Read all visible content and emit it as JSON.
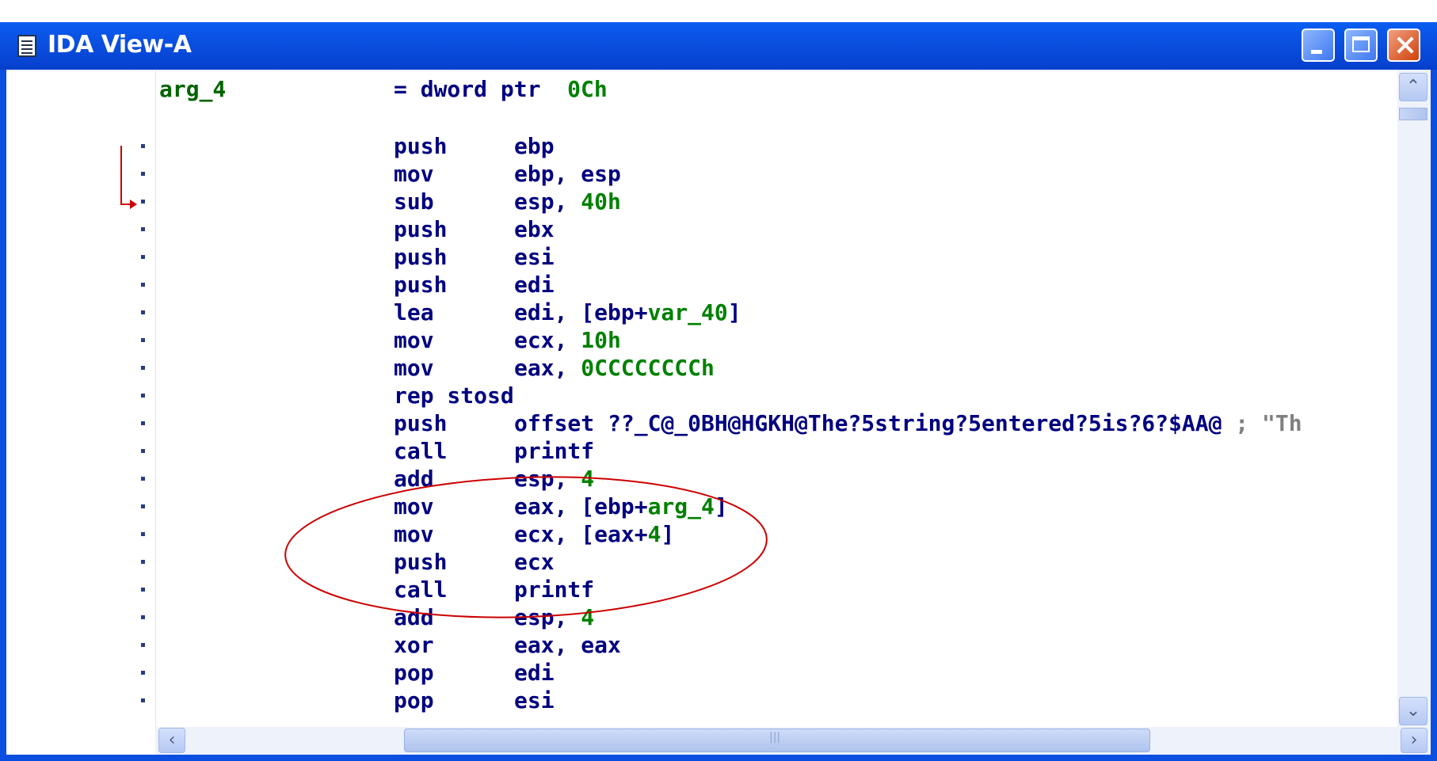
{
  "window": {
    "title": "IDA View-A",
    "title_icon": "document-icon",
    "buttons": [
      "minimize-icon",
      "maximize-icon",
      "close-icon"
    ]
  },
  "colors": {
    "titlebar": "#0a4fe0",
    "mnemonic": "#000080",
    "number": "#008000",
    "label": "#006400",
    "comment": "#808080",
    "annotation": "#cc0000"
  },
  "listing": {
    "header": {
      "label": "arg_4",
      "eq": "= dword ptr",
      "value": "0Ch"
    },
    "lines": [
      {
        "mnem": "push",
        "op": "ebp",
        "num": ""
      },
      {
        "mnem": "mov",
        "op": "ebp, esp",
        "num": ""
      },
      {
        "mnem": "sub",
        "op": "esp, ",
        "num": "40h"
      },
      {
        "mnem": "push",
        "op": "ebx",
        "num": ""
      },
      {
        "mnem": "push",
        "op": "esi",
        "num": ""
      },
      {
        "mnem": "push",
        "op": "edi",
        "num": ""
      },
      {
        "mnem": "lea",
        "op": "edi, [ebp+",
        "num": "var_40",
        "post": "]"
      },
      {
        "mnem": "mov",
        "op": "ecx, ",
        "num": "10h"
      },
      {
        "mnem": "mov",
        "op": "eax, ",
        "num": "0CCCCCCCCh"
      },
      {
        "mnem": "rep stosd",
        "op": "",
        "num": ""
      },
      {
        "mnem": "push",
        "op": "offset ??_C@_0BH@HGKH@The?5string?5entered?5is?6?$AA@",
        "num": "",
        "comment": " ; \"Th"
      },
      {
        "mnem": "call",
        "op": "printf",
        "num": ""
      },
      {
        "mnem": "add",
        "op": "esp, ",
        "num": "4"
      },
      {
        "mnem": "mov",
        "op": "eax, [ebp+",
        "num": "arg_4",
        "post": "]"
      },
      {
        "mnem": "mov",
        "op": "ecx, [eax+",
        "num": "4",
        "post": "]"
      },
      {
        "mnem": "push",
        "op": "ecx",
        "num": ""
      },
      {
        "mnem": "call",
        "op": "printf",
        "num": ""
      },
      {
        "mnem": "add",
        "op": "esp, ",
        "num": "4"
      },
      {
        "mnem": "xor",
        "op": "eax, eax",
        "num": ""
      },
      {
        "mnem": "pop",
        "op": "edi",
        "num": ""
      },
      {
        "mnem": "pop",
        "op": "esi",
        "num": ""
      }
    ]
  },
  "scrollbars": {
    "up_arrow": "chevron-up-icon",
    "down_arrow": "chevron-down-icon",
    "left_arrow": "chevron-left-icon",
    "right_arrow": "chevron-right-icon"
  }
}
